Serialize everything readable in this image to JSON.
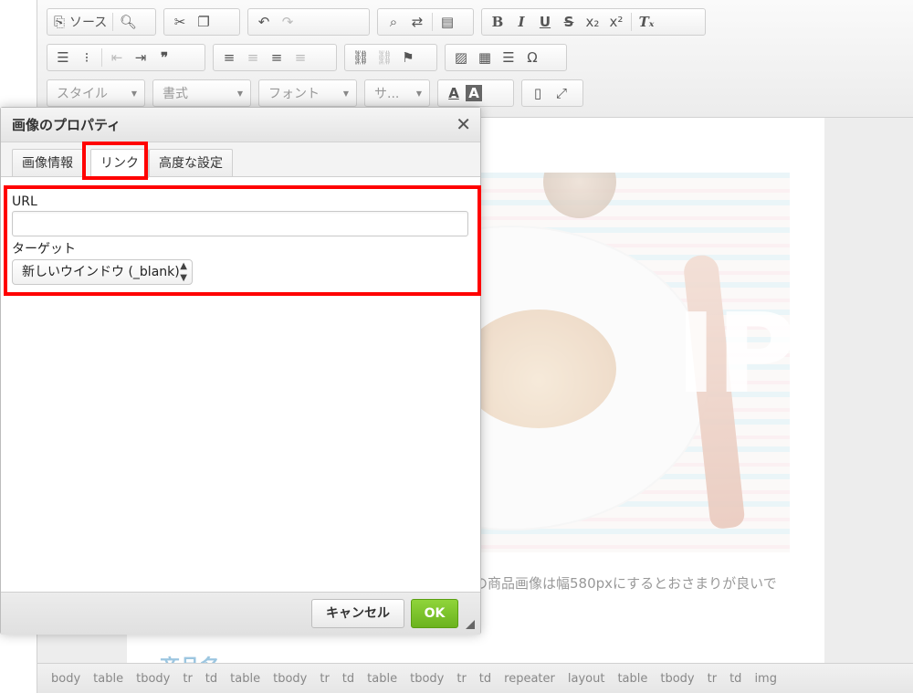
{
  "toolbar": {
    "source_label": "ソース",
    "combos": [
      "スタイル",
      "書式",
      "フォント",
      "サ..."
    ],
    "text_color_label": "A",
    "bg_color_label": "A"
  },
  "content": {
    "watermark": "IPLE",
    "caption": "の商品画像は幅580pxにするとおさまりが良いで",
    "teaser": "商品名"
  },
  "statusbar": {
    "crumbs": [
      "body",
      "table",
      "tbody",
      "tr",
      "td",
      "table",
      "tbody",
      "tr",
      "td",
      "table",
      "tbody",
      "tr",
      "td",
      "repeater",
      "layout",
      "table",
      "tbody",
      "tr",
      "td",
      "img"
    ]
  },
  "dialog": {
    "title": "画像のプロパティ",
    "close": "✕",
    "tabs": [
      "画像情報",
      "リンク",
      "高度な設定"
    ],
    "url_label": "URL",
    "url_value": "",
    "target_label": "ターゲット",
    "target_selected": "新しいウインドウ (_blank)",
    "cancel_label": "キャンセル",
    "ok_label": "OK"
  },
  "colors": {
    "highlight": "#ff0000",
    "ok_green": "#7cc22c",
    "caption_gray": "#999999"
  }
}
